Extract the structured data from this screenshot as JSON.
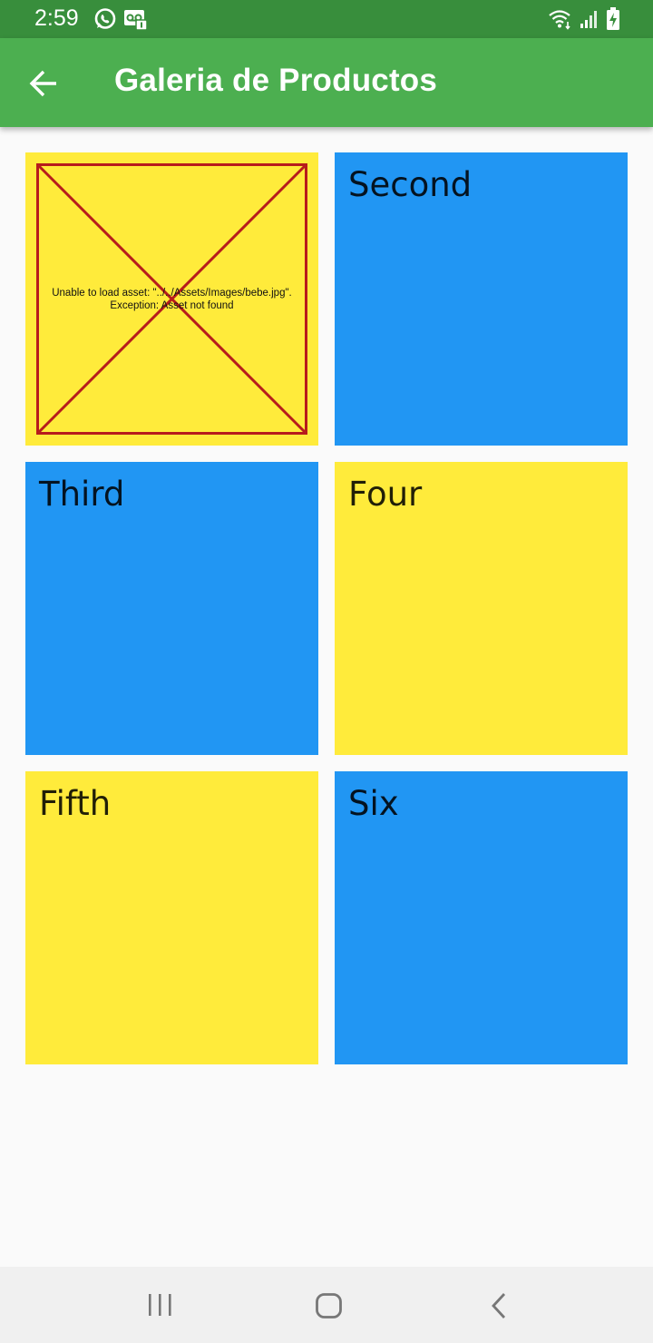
{
  "status_bar": {
    "time": "2:59",
    "left_icons": [
      "whatsapp-icon",
      "voicemail-icon"
    ],
    "right_icons": [
      "wifi-icon",
      "signal-icon",
      "battery-charging-icon"
    ],
    "background": "#388e3c"
  },
  "app_bar": {
    "title": "Galeria de Productos",
    "back_icon": "arrow-back-icon",
    "background": "#4caf50"
  },
  "gallery": {
    "tiles": [
      {
        "label": "",
        "color": "yellow",
        "error": "Unable to load asset: \"../../Assets/Images/bebe.jpg\".",
        "error_line2": "Exception: Asset not found"
      },
      {
        "label": "Second",
        "color": "blue"
      },
      {
        "label": "Third",
        "color": "blue"
      },
      {
        "label": "Four",
        "color": "yellow"
      },
      {
        "label": "Fifth",
        "color": "yellow"
      },
      {
        "label": "Six",
        "color": "blue"
      }
    ],
    "colors": {
      "yellow": "#ffeb3b",
      "blue": "#2196f3",
      "error_border": "#b71c1c"
    }
  },
  "nav_bar": {
    "buttons": [
      "recents-icon",
      "home-icon",
      "back-icon"
    ]
  }
}
